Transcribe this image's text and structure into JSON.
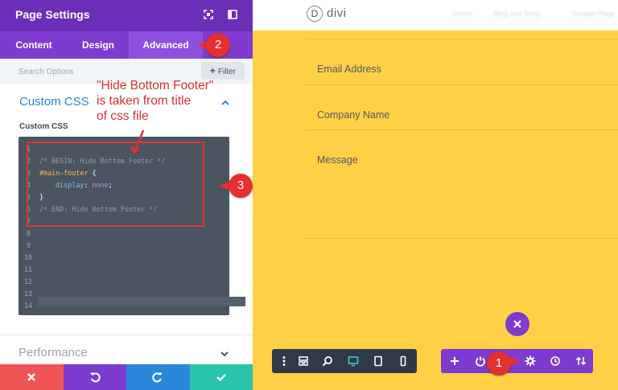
{
  "panel": {
    "title": "Page Settings",
    "tabs": [
      {
        "label": "Content"
      },
      {
        "label": "Design"
      },
      {
        "label": "Advanced"
      }
    ],
    "search_placeholder": "Search Options",
    "filter_label": "Filter",
    "section_title": "Custom CSS",
    "field_label": "Custom CSS",
    "code": {
      "line_numbers": [
        "1",
        "2",
        "3",
        "4",
        "5",
        "6",
        "7",
        "8",
        "9",
        "10",
        "11",
        "12",
        "13",
        "14"
      ],
      "comment_begin": "/* BEGIN: Hide Bottom Footer */",
      "selector": "#main-footer",
      "open_brace": " {",
      "property": "display",
      "colon": ": ",
      "value": "none",
      "semicolon": ";",
      "close_brace": "}",
      "comment_end": "/* END: Hide Bottom Footer */"
    },
    "performance_title": "Performance"
  },
  "annotation": {
    "lines": [
      "\"Hide Bottom Footer\"",
      "is taken from title",
      "of css file"
    ],
    "badges": [
      "1",
      "2",
      "3"
    ]
  },
  "preview": {
    "logo_letter": "D",
    "logo_text": "divi",
    "nav": [
      "Home",
      "Blog and Shop",
      "Sample Page"
    ],
    "form_fields": [
      "Email Address",
      "Company Name",
      "Message"
    ]
  },
  "colors": {
    "purple_dark": "#6c2eb9",
    "purple": "#7e3bd0",
    "accent_blue": "#2b87da",
    "preview_yellow": "#fdd046",
    "annotation_red": "#e5302f",
    "discard_red": "#ef5555",
    "undo_purple": "#7e3bd0",
    "redo_blue": "#2b87da",
    "save_green": "#29c4a9"
  },
  "icons": {
    "header": [
      "expand-icon",
      "sidebar-toggle-icon"
    ],
    "bottom_bar": [
      "close-icon",
      "undo-icon",
      "redo-icon",
      "check-icon"
    ],
    "dark_toolbar": [
      "more-icon",
      "wireframe-icon",
      "zoom-icon",
      "desktop-icon",
      "tablet-icon",
      "phone-icon"
    ],
    "purple_toolbar": [
      "plus-icon",
      "power-icon",
      "gear-icon",
      "history-icon",
      "portability-icon"
    ]
  }
}
